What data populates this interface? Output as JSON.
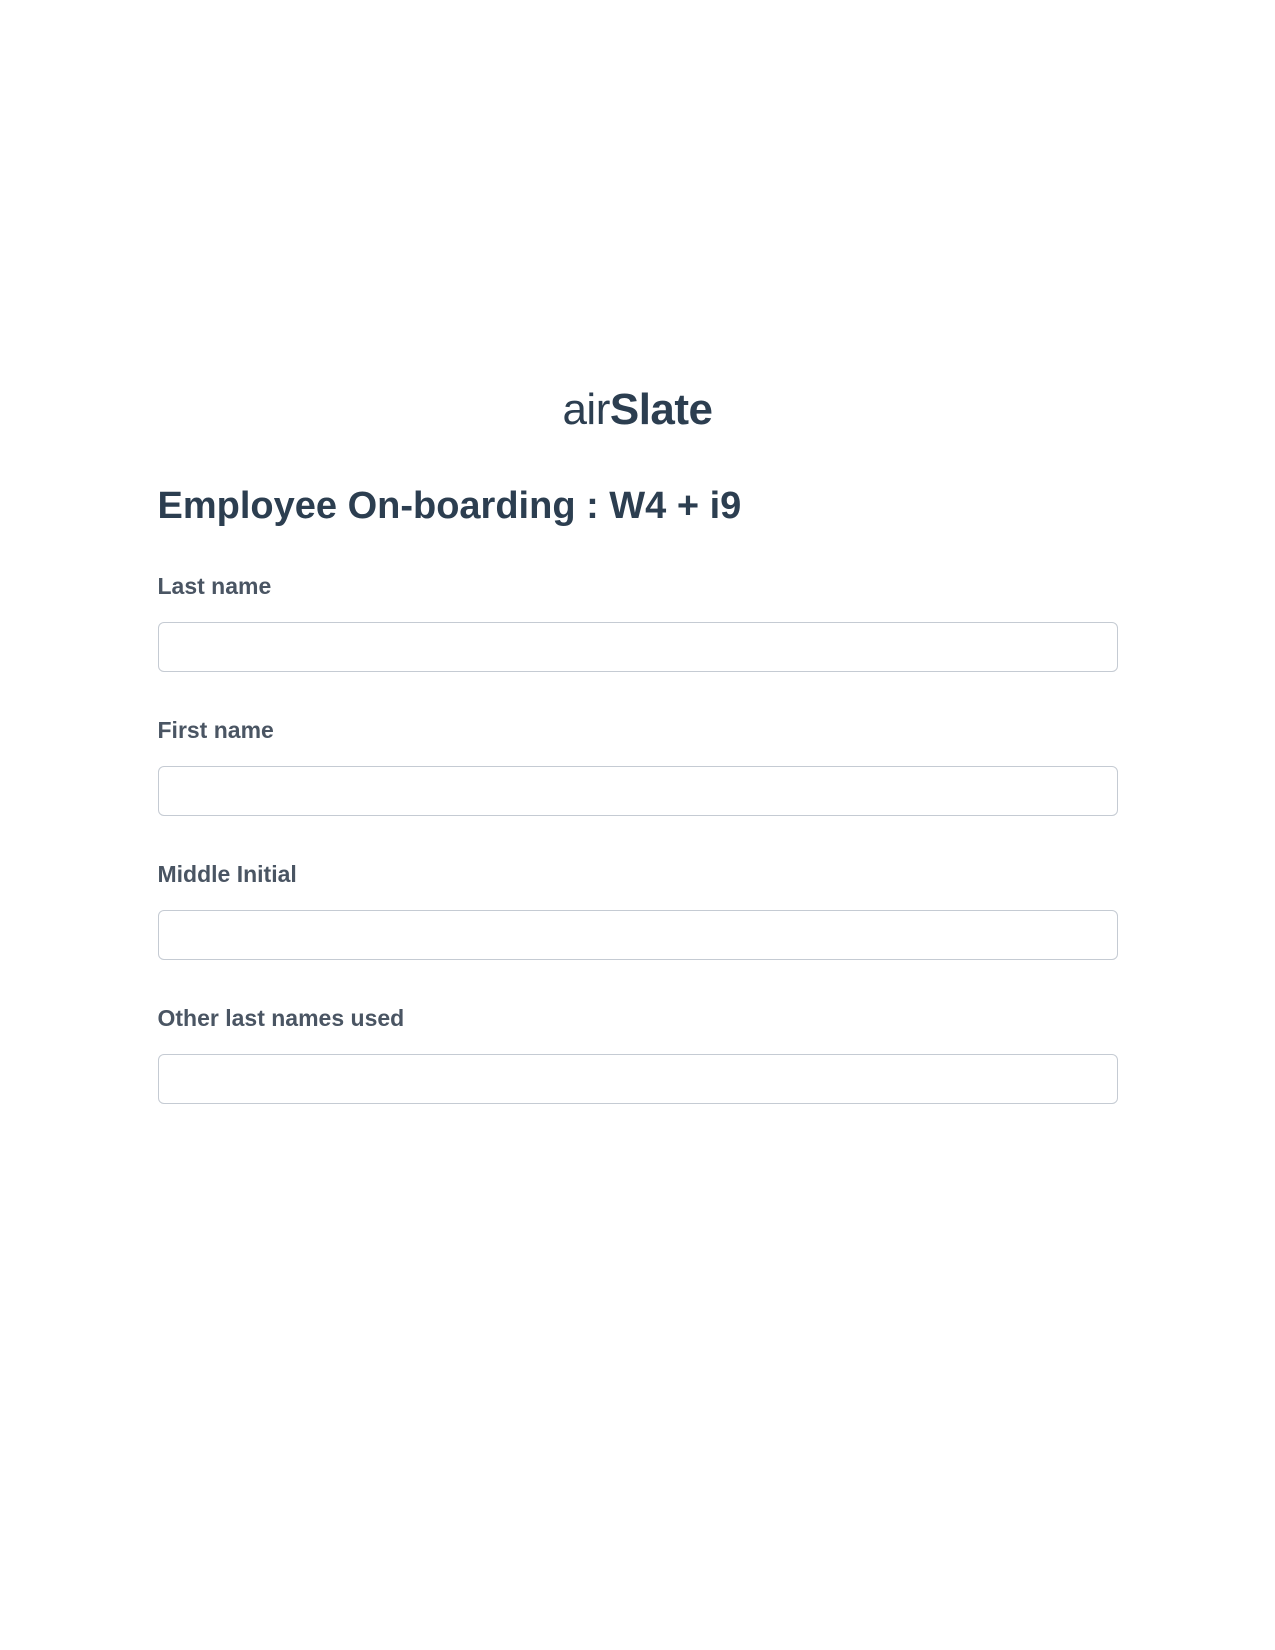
{
  "brand": {
    "prefix": "air",
    "suffix": "Slate"
  },
  "form": {
    "title": "Employee On-boarding : W4 + i9",
    "fields": {
      "last_name": {
        "label": "Last name",
        "value": ""
      },
      "first_name": {
        "label": "First name",
        "value": ""
      },
      "middle_initial": {
        "label": "Middle Initial",
        "value": ""
      },
      "other_last_names": {
        "label": "Other last names used",
        "value": ""
      }
    }
  }
}
